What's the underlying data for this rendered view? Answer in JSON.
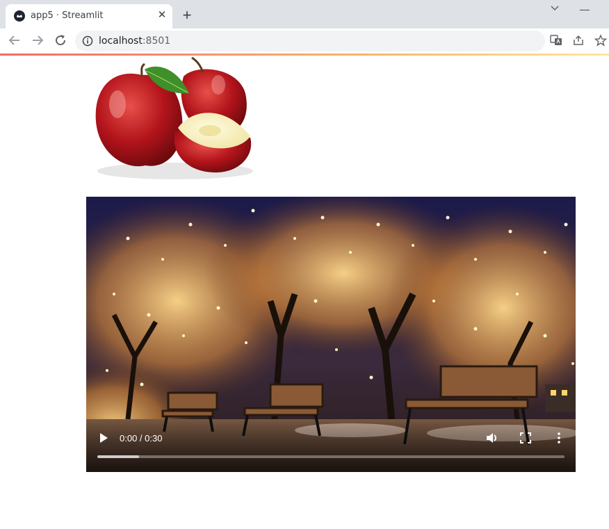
{
  "browser": {
    "tab_title": "app5 · Streamlit",
    "tab_close": "✕",
    "new_tab": "+",
    "minimize": "—",
    "url_host": "localhost",
    "url_port": ":8501"
  },
  "content": {
    "image_alt": "apples",
    "video": {
      "time_display": "0:00 / 0:30",
      "buffered_fraction": 0.09
    }
  },
  "colors": {
    "accent_gradient_start": "#f16a6a",
    "accent_gradient_end": "#fbe79d",
    "tab_strip": "#dee1e6"
  }
}
